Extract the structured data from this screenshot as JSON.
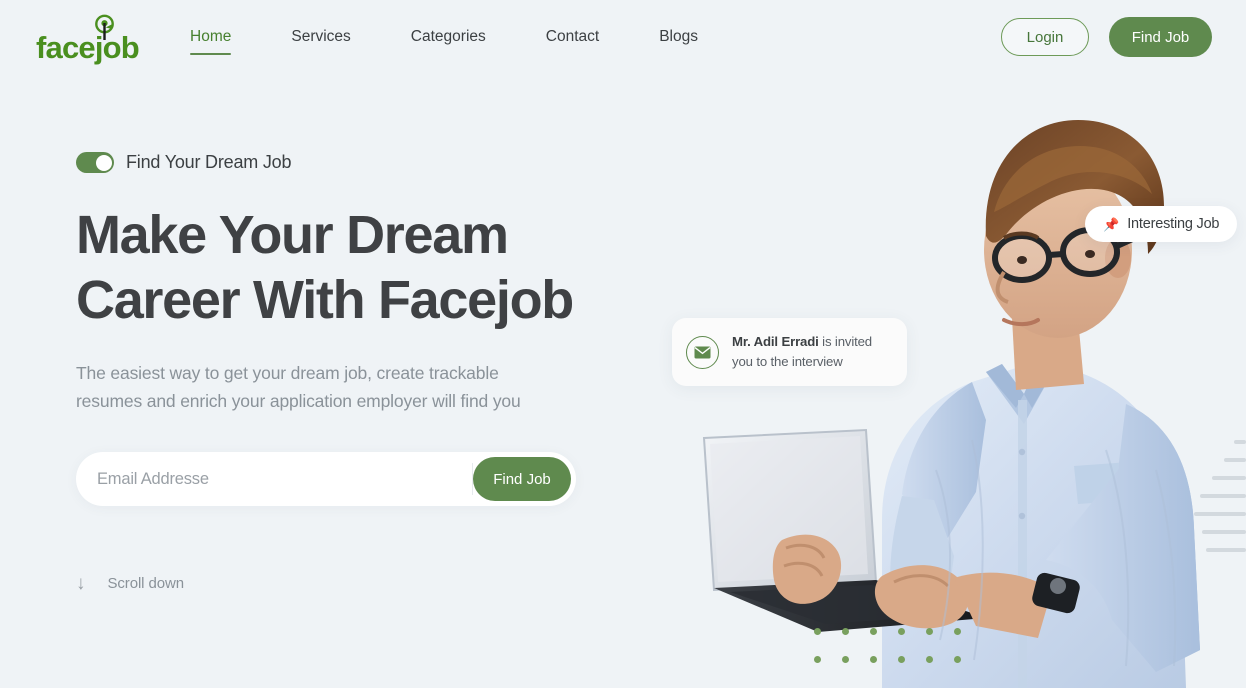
{
  "brand": {
    "logo_text": "facejob",
    "logo_icon": "tree-mark-icon",
    "logo_color": "#4a8f1f"
  },
  "theme": {
    "background": "#eff3f6",
    "accent_green": "#5f8a4e",
    "heading_color": "#3f4144",
    "muted_text": "#8a9299",
    "dot_green": "#79a05e",
    "deco_line_gray": "#d3d9de"
  },
  "nav": {
    "links": [
      {
        "label": "Home",
        "active": true
      },
      {
        "label": "Services",
        "active": false
      },
      {
        "label": "Categories",
        "active": false
      },
      {
        "label": "Contact",
        "active": false
      },
      {
        "label": "Blogs",
        "active": false
      }
    ],
    "login_label": "Login",
    "find_job_label": "Find Job"
  },
  "hero": {
    "eyebrow": "Find Your Dream Job",
    "toggle_state": "on",
    "title_line1": "Make Your Dream",
    "title_line2": "Career With Facejob",
    "subtitle_line1": "The easiest way to get your dream job, create trackable",
    "subtitle_line2": "resumes and enrich your application employer will find you",
    "search": {
      "placeholder": "Email Addresse",
      "value": "",
      "button_label": "Find Job"
    },
    "scroll": {
      "arrow_icon": "arrow-down-icon",
      "label": "Scroll down"
    }
  },
  "floating": {
    "badge": {
      "pin_icon": "📌",
      "label": "Interesting Job"
    },
    "invite_card": {
      "mail_icon": "envelope-icon",
      "name": "Mr. Adil Erradi",
      "message_line1": " is invited",
      "message_line2": "you to the interview"
    }
  },
  "decor": {
    "dot_rows": 2,
    "dot_cols": 6,
    "line_widths": [
      12,
      22,
      34,
      46,
      52,
      44,
      40
    ]
  }
}
